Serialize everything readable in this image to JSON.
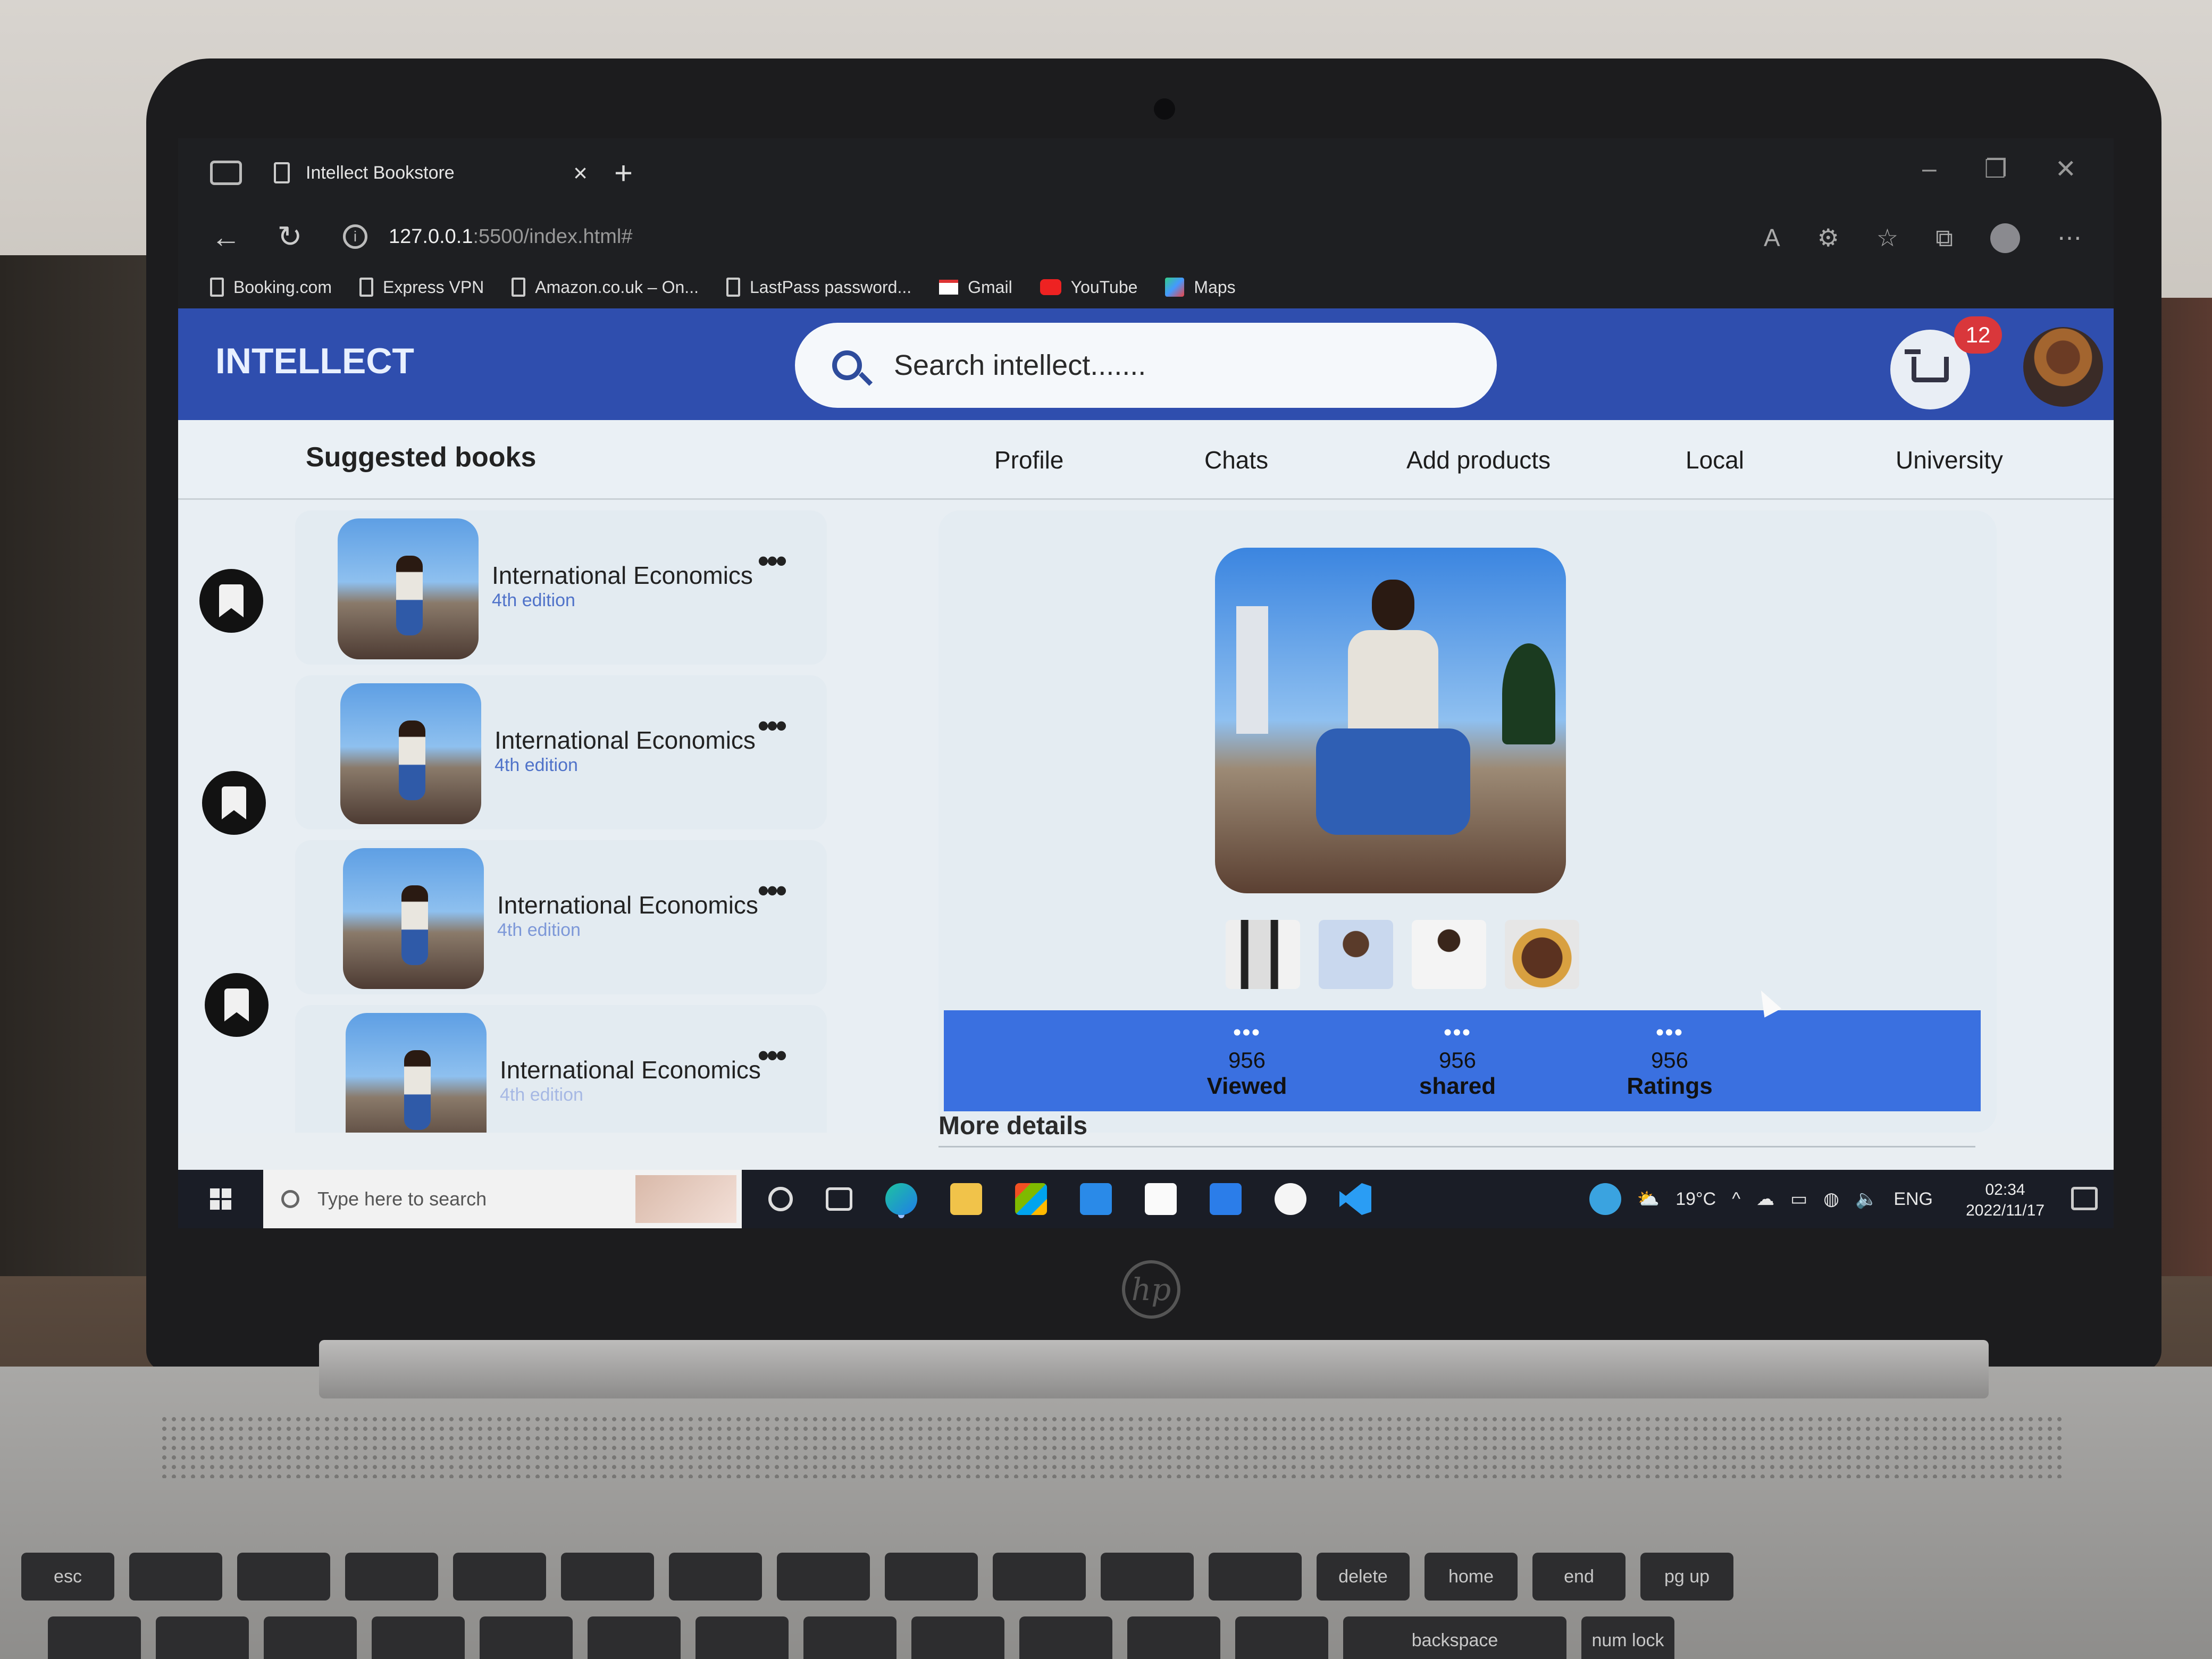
{
  "browser": {
    "tab_title": "Intellect Bookstore",
    "tab_close": "×",
    "new_tab": "+",
    "url_host": "127.0.0.1",
    "url_path": ":5500/index.html#",
    "bookmarks": [
      {
        "label": "Booking.com",
        "icon": "page-icon"
      },
      {
        "label": "Express VPN",
        "icon": "page-icon"
      },
      {
        "label": "Amazon.co.uk – On...",
        "icon": "page-icon"
      },
      {
        "label": "LastPass password...",
        "icon": "page-icon"
      },
      {
        "label": "Gmail",
        "icon": "gmail-icon"
      },
      {
        "label": "YouTube",
        "icon": "youtube-icon"
      },
      {
        "label": "Maps",
        "icon": "maps-icon"
      }
    ]
  },
  "header": {
    "brand": "INTELLECT",
    "search_placeholder": "Search intellect.......",
    "cart_count": "12"
  },
  "subnav": {
    "title": "Suggested books",
    "links": [
      "Profile",
      "Chats",
      "Add products",
      "Local",
      "University"
    ]
  },
  "books": [
    {
      "title": "International Economics",
      "edition": "4th edition"
    },
    {
      "title": "International Economics",
      "edition": "4th edition"
    },
    {
      "title": "International Economics",
      "edition": "4th edition"
    },
    {
      "title": "International Economics",
      "edition": "4th edition"
    }
  ],
  "stats": [
    {
      "value": "956",
      "label": "Viewed"
    },
    {
      "value": "956",
      "label": "shared"
    },
    {
      "value": "956",
      "label": "Ratings"
    }
  ],
  "more_details": "More details",
  "taskbar": {
    "search_placeholder": "Type here to search",
    "temperature": "19°C",
    "language": "ENG",
    "time": "02:34",
    "date": "2022/11/17"
  },
  "colors": {
    "header_blue": "#2f4eae",
    "stats_blue": "#3a70e0",
    "badge_red": "#d9373b"
  }
}
